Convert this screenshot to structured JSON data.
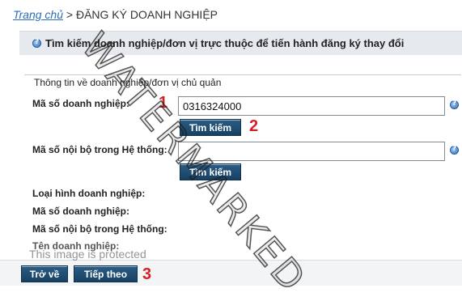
{
  "breadcrumb": {
    "home": "Trang chủ",
    "separator": ">",
    "current": "ĐĂNG KÝ DOANH NGHIỆP"
  },
  "panel": {
    "title": "Tìm kiếm doanh nghiệp/đơn vị trực thuộc để tiến hành đăng ký thay đổi",
    "section_label": "Thông tin về doanh nghiệp/đơn vị chủ quản"
  },
  "form": {
    "enterprise_code_label": "Mã số doanh nghiệp:",
    "enterprise_code_value": "0316324000",
    "internal_code_label": "Mã số nội bộ trong Hệ thống:",
    "internal_code_value": "",
    "search_button": "Tìm kiếm",
    "search_button_2": "Tìm kiếm"
  },
  "results": {
    "type_label": "Loại hình doanh nghiệp:",
    "enterprise_code_label": "Mã số doanh nghiệp:",
    "internal_code_label": "Mã số nội bộ trong Hệ thống:",
    "name_label": "Tên doanh nghiệp:"
  },
  "actions": {
    "back": "Trở về",
    "next": "Tiếp theo"
  },
  "annotations": {
    "step1": "1",
    "step2": "2",
    "step3": "3"
  },
  "overlay": {
    "watermark": "WATERMARKED",
    "protected_notice": "This image is protected"
  },
  "icons": {
    "header_info": "info-icon",
    "help": "help-icon"
  },
  "colors": {
    "button_bg": "#1f4f75",
    "link": "#2a6db8",
    "step_number": "#d41f26",
    "panel_header_bg": "#e6eaee"
  }
}
